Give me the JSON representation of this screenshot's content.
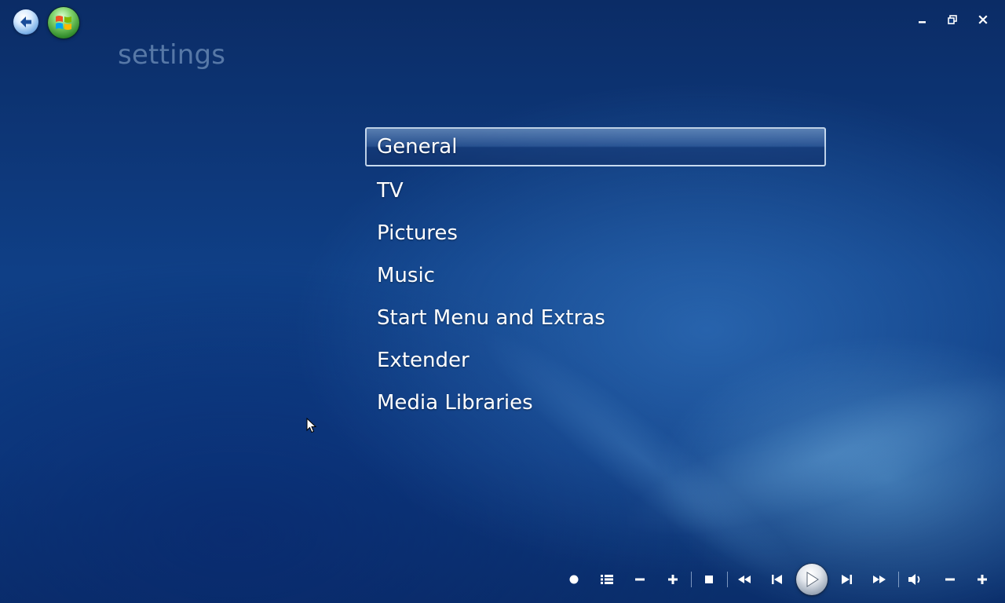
{
  "page": {
    "title": "settings"
  },
  "nav": {
    "back_icon": "back-arrow-icon",
    "start_icon": "windows-logo-icon"
  },
  "window_controls": {
    "minimize_icon": "minimize-icon",
    "restore_icon": "restore-icon",
    "close_icon": "close-icon"
  },
  "menu": {
    "selected_index": 0,
    "items": [
      {
        "label": "General"
      },
      {
        "label": "TV"
      },
      {
        "label": "Pictures"
      },
      {
        "label": "Music"
      },
      {
        "label": "Start Menu and Extras"
      },
      {
        "label": "Extender"
      },
      {
        "label": "Media Libraries"
      }
    ]
  },
  "transport": {
    "buttons": [
      "record-icon",
      "guide-list-icon",
      "channel-down-icon",
      "channel-up-icon",
      "stop-icon",
      "rewind-icon",
      "previous-icon",
      "play-icon",
      "next-icon",
      "fast-forward-icon",
      "mute-volume-icon",
      "volume-down-icon",
      "volume-up-icon"
    ]
  },
  "colors": {
    "background_dark": "#0b2c66",
    "background_mid": "#0f3f86",
    "title_text": "#96b4d7",
    "menu_text": "#ffffff",
    "selection_border": "#dcebfa"
  }
}
